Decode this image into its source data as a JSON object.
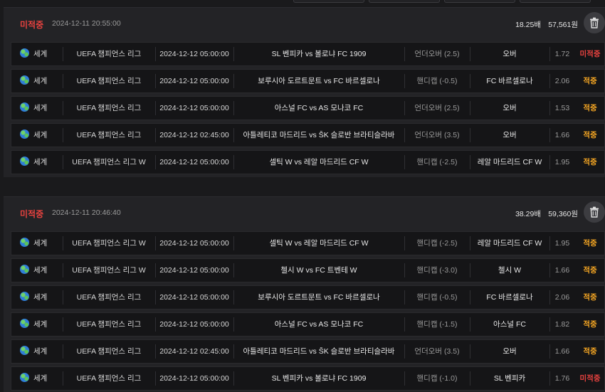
{
  "colors": {
    "miss": "#e8423f",
    "hit": "#f5a623",
    "background": "#1a1a1c",
    "card": "#232326",
    "row": "#151517"
  },
  "icons": {
    "region": "globe-icon",
    "delete": "trash-icon"
  },
  "bets": [
    {
      "status": "미적중",
      "time": "2024-12-11 20:55:00",
      "total_odds": "18.25배",
      "amount": "57,561원",
      "rows": [
        {
          "region": "세계",
          "league": "UEFA 챔피언스 리그",
          "time": "2024-12-12 05:00:00",
          "match": "SL 벤피카 vs 볼로냐 FC 1909",
          "market": "언더오버 (2.5)",
          "pick": "오버",
          "odds": "1.72",
          "result": "미적중",
          "result_type": "miss"
        },
        {
          "region": "세계",
          "league": "UEFA 챔피언스 리그",
          "time": "2024-12-12 05:00:00",
          "match": "보루시아 도르트문트 vs FC 바르셀로나",
          "market": "핸디캡 (-0.5)",
          "pick": "FC 바르셀로나",
          "odds": "2.06",
          "result": "적중",
          "result_type": "hit"
        },
        {
          "region": "세계",
          "league": "UEFA 챔피언스 리그",
          "time": "2024-12-12 05:00:00",
          "match": "아스널 FC vs AS 모나코 FC",
          "market": "언더오버 (2.5)",
          "pick": "오버",
          "odds": "1.53",
          "result": "적중",
          "result_type": "hit"
        },
        {
          "region": "세계",
          "league": "UEFA 챔피언스 리그",
          "time": "2024-12-12 02:45:00",
          "match": "아틀레티코 마드리드 vs ŠK 슬로반 브라티슬라바",
          "market": "언더오버 (3.5)",
          "pick": "오버",
          "odds": "1.66",
          "result": "적중",
          "result_type": "hit"
        },
        {
          "region": "세계",
          "league": "UEFA 챔피언스 리그 W",
          "time": "2024-12-12 05:00:00",
          "match": "셀틱 W vs 레알 마드리드 CF W",
          "market": "핸디캡 (-2.5)",
          "pick": "레알 마드리드 CF W",
          "odds": "1.95",
          "result": "적중",
          "result_type": "hit"
        }
      ]
    },
    {
      "status": "미적중",
      "time": "2024-12-11 20:46:40",
      "total_odds": "38.29배",
      "amount": "59,360원",
      "rows": [
        {
          "region": "세계",
          "league": "UEFA 챔피언스 리그 W",
          "time": "2024-12-12 05:00:00",
          "match": "셀틱 W vs 레알 마드리드 CF W",
          "market": "핸디캡 (-2.5)",
          "pick": "레알 마드리드 CF W",
          "odds": "1.95",
          "result": "적중",
          "result_type": "hit"
        },
        {
          "region": "세계",
          "league": "UEFA 챔피언스 리그 W",
          "time": "2024-12-12 05:00:00",
          "match": "첼시 W vs FC 트벤테 W",
          "market": "핸디캡 (-3.0)",
          "pick": "첼시 W",
          "odds": "1.66",
          "result": "적중",
          "result_type": "hit"
        },
        {
          "region": "세계",
          "league": "UEFA 챔피언스 리그",
          "time": "2024-12-12 05:00:00",
          "match": "보루시아 도르트문트 vs FC 바르셀로나",
          "market": "핸디캡 (-0.5)",
          "pick": "FC 바르셀로나",
          "odds": "2.06",
          "result": "적중",
          "result_type": "hit"
        },
        {
          "region": "세계",
          "league": "UEFA 챔피언스 리그",
          "time": "2024-12-12 05:00:00",
          "match": "아스널 FC vs AS 모나코 FC",
          "market": "핸디캡 (-1.5)",
          "pick": "아스널 FC",
          "odds": "1.82",
          "result": "적중",
          "result_type": "hit"
        },
        {
          "region": "세계",
          "league": "UEFA 챔피언스 리그",
          "time": "2024-12-12 02:45:00",
          "match": "아틀레티코 마드리드 vs ŠK 슬로반 브라티슬라바",
          "market": "언더오버 (3.5)",
          "pick": "오버",
          "odds": "1.66",
          "result": "적중",
          "result_type": "hit"
        },
        {
          "region": "세계",
          "league": "UEFA 챔피언스 리그",
          "time": "2024-12-12 05:00:00",
          "match": "SL 벤피카 vs 볼로냐 FC 1909",
          "market": "핸디캡 (-1.0)",
          "pick": "SL 벤피카",
          "odds": "1.76",
          "result": "미적중",
          "result_type": "miss"
        }
      ]
    }
  ]
}
